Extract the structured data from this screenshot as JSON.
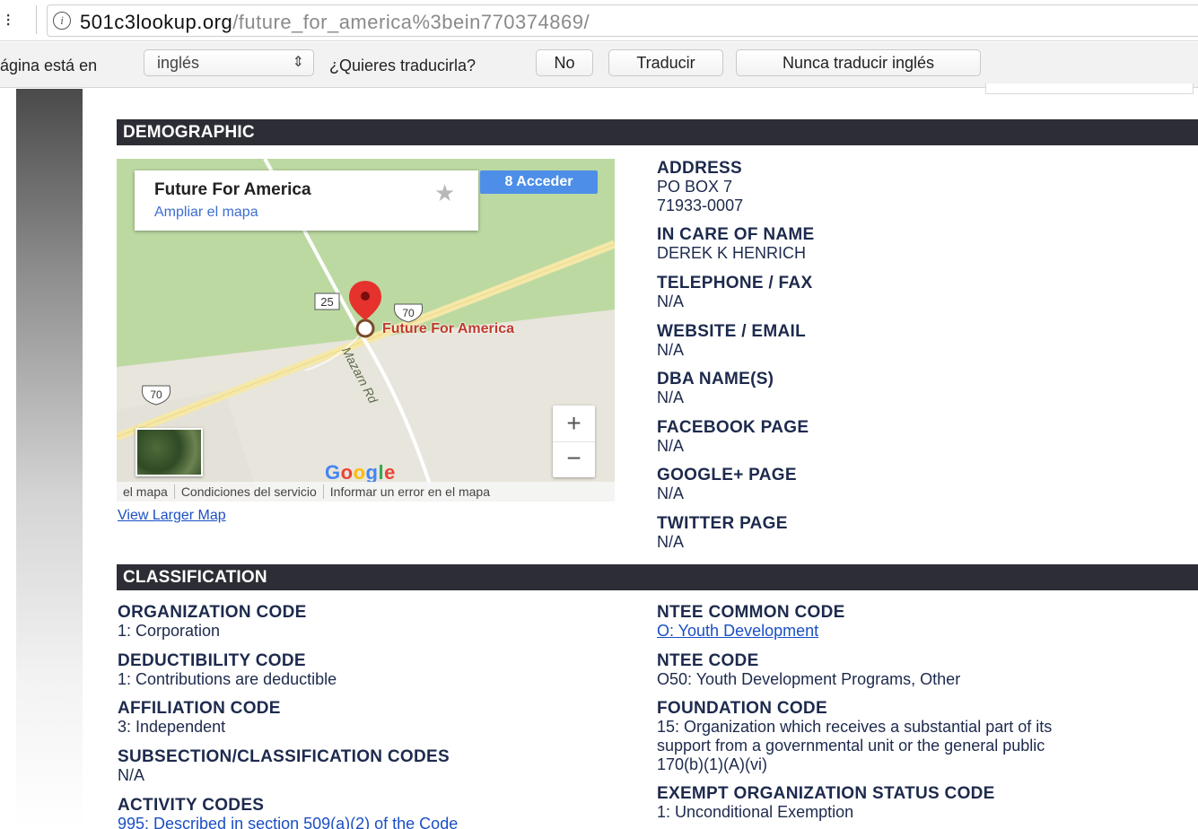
{
  "browser": {
    "url_host": "501c3lookup.org",
    "url_path": "/future_for_america%3bein770374869/"
  },
  "translate_bar": {
    "label": "ágina está en",
    "language": "inglés",
    "question": "¿Quieres traducirla?",
    "no_label": "No",
    "translate_label": "Traducir",
    "never_label": "Nunca traducir inglés"
  },
  "demographic": {
    "title": "DEMOGRAPHIC",
    "map": {
      "place_name": "Future For America",
      "expand_link": "Ampliar el mapa",
      "signin_label": "Acceder",
      "pin_label": "Future For America",
      "route_25": "25",
      "route_70_a": "70",
      "route_70_b": "70",
      "road_name": "Mazarn Rd",
      "zoom_in": "+",
      "zoom_out": "−",
      "footer": [
        "el mapa",
        "Condiciones del servicio",
        "Informar un error en el mapa"
      ],
      "google_letters": [
        "G",
        "o",
        "o",
        "g",
        "l",
        "e"
      ],
      "google_colors": [
        "#4285f4",
        "#ea4335",
        "#fbbc05",
        "#4285f4",
        "#34a853",
        "#ea4335"
      ]
    },
    "view_larger": "View Larger Map",
    "address_label": "ADDRESS",
    "address_line1": "PO BOX 7",
    "address_line2": "71933-0007",
    "care_label": "IN CARE OF NAME",
    "care_value": "DEREK K HENRICH",
    "phone_label": "TELEPHONE / FAX",
    "phone_value": "N/A",
    "web_label": "WEBSITE / EMAIL",
    "web_value": "N/A",
    "dba_label": "DBA NAME(S)",
    "dba_value": "N/A",
    "facebook_label": "FACEBOOK PAGE",
    "facebook_value": "N/A",
    "google_label": "GOOGLE+ PAGE",
    "google_value": "N/A",
    "twitter_label": "TWITTER PAGE",
    "twitter_value": "N/A"
  },
  "classification": {
    "title": "CLASSIFICATION",
    "org_label": "ORGANIZATION CODE",
    "org_value": "1: Corporation",
    "deduct_label": "DEDUCTIBILITY CODE",
    "deduct_value": "1: Contributions are deductible",
    "affil_label": "AFFILIATION CODE",
    "affil_value": "3: Independent",
    "subsection_label": "SUBSECTION/CLASSIFICATION CODES",
    "subsection_value": "N/A",
    "activity_label": "ACTIVITY CODES",
    "activity_value": "995: Described in section 509(a)(2) of the Code",
    "ntee_common_label": "NTEE COMMON CODE",
    "ntee_common_value": "O: Youth Development",
    "ntee_label": "NTEE CODE",
    "ntee_value": "O50: Youth Development Programs, Other",
    "foundation_label": "FOUNDATION CODE",
    "foundation_line1": "15: Organization which receives a substantial part of its",
    "foundation_line2": "support from a governmental unit or the general public",
    "foundation_line3": "170(b)(1)(A)(vi)",
    "exempt_label": "EXEMPT ORGANIZATION STATUS CODE",
    "exempt_value": "1: Unconditional Exemption"
  }
}
